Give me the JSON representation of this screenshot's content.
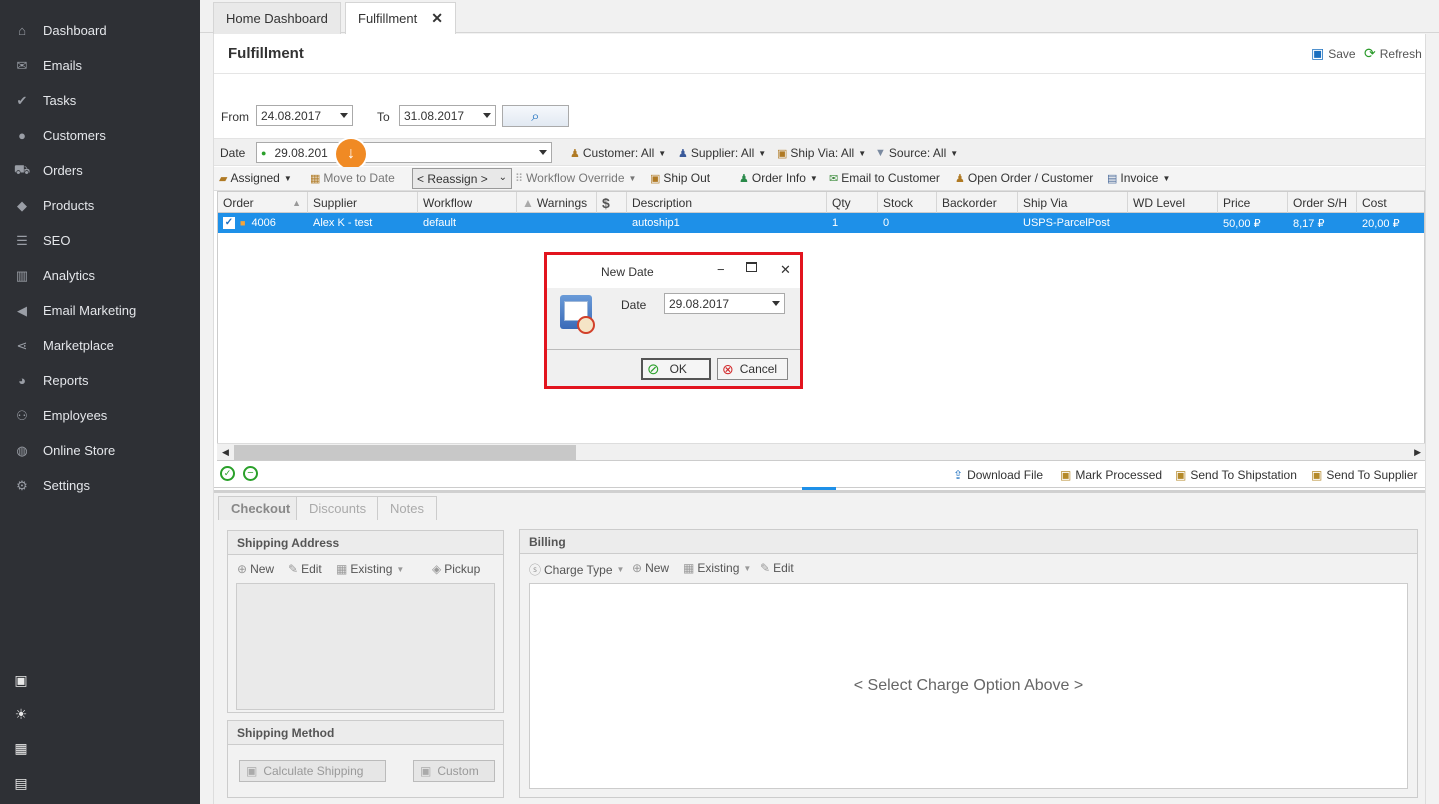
{
  "sidebar": {
    "items": [
      {
        "label": "Dashboard",
        "icon": "home-icon"
      },
      {
        "label": "Emails",
        "icon": "envelope-icon"
      },
      {
        "label": "Tasks",
        "icon": "tasks-icon"
      },
      {
        "label": "Customers",
        "icon": "user-icon"
      },
      {
        "label": "Orders",
        "icon": "cart-icon"
      },
      {
        "label": "Products",
        "icon": "tag-icon"
      },
      {
        "label": "SEO",
        "icon": "sliders-icon"
      },
      {
        "label": "Analytics",
        "icon": "bar-chart-icon"
      },
      {
        "label": "Email Marketing",
        "icon": "megaphone-icon"
      },
      {
        "label": "Marketplace",
        "icon": "share-icon"
      },
      {
        "label": "Reports",
        "icon": "pie-chart-icon"
      },
      {
        "label": "Employees",
        "icon": "users-icon"
      },
      {
        "label": "Online Store",
        "icon": "globe-icon"
      },
      {
        "label": "Settings",
        "icon": "gear-icon"
      }
    ]
  },
  "tabs": {
    "home": "Home Dashboard",
    "fulfillment": "Fulfillment"
  },
  "header": {
    "title": "Fulfillment",
    "save": "Save",
    "refresh": "Refresh"
  },
  "filters": {
    "from_label": "From",
    "from_value": "24.08.2017",
    "to_label": "To",
    "to_value": "31.08.2017",
    "date_label": "Date",
    "date_value": "29.08.201",
    "customer": "Customer: All",
    "supplier": "Supplier: All",
    "ship_via": "Ship Via: All",
    "source": "Source: All"
  },
  "toolbar": {
    "assigned": "Assigned",
    "move_to_date": "Move to Date",
    "reassign": "< Reassign >",
    "workflow_override": "Workflow Override",
    "ship_out": "Ship Out",
    "order_info": "Order Info",
    "email_customer": "Email to Customer",
    "open_order": "Open Order / Customer",
    "invoice": "Invoice"
  },
  "grid": {
    "columns": [
      "Order",
      "Supplier",
      "Workflow",
      "Warnings",
      "$",
      "Description",
      "Qty",
      "Stock",
      "Backorder",
      "Ship Via",
      "WD Level",
      "Price",
      "Order S/H",
      "Cost"
    ],
    "rows": [
      {
        "order": "4006",
        "supplier": "Alex K - test",
        "workflow": "default",
        "warnings": "",
        "dollar": "",
        "description": "autoship1",
        "qty": "1",
        "stock": "0",
        "backorder": "",
        "ship_via": "USPS-ParcelPost",
        "wd_level": "",
        "price": "50,00 ₽",
        "order_sh": "8,17 ₽",
        "cost": "20,00 ₽"
      }
    ]
  },
  "actions": {
    "download": "Download File",
    "mark_processed": "Mark Processed",
    "send_shipstation": "Send To Shipstation",
    "send_supplier": "Send To Supplier"
  },
  "lower_tabs": {
    "checkout": "Checkout",
    "discounts": "Discounts",
    "notes": "Notes"
  },
  "shipping_address": {
    "title": "Shipping Address",
    "new": "New",
    "edit": "Edit",
    "existing": "Existing",
    "pickup": "Pickup"
  },
  "shipping_method": {
    "title": "Shipping Method",
    "calculate": "Calculate Shipping",
    "custom": "Custom"
  },
  "billing": {
    "title": "Billing",
    "charge_type": "Charge Type",
    "new": "New",
    "existing": "Existing",
    "edit": "Edit",
    "placeholder": "< Select Charge Option Above >"
  },
  "modal": {
    "title": "New Date",
    "date_label": "Date",
    "date_value": "29.08.2017",
    "ok": "OK",
    "cancel": "Cancel"
  },
  "colors": {
    "sidebar_bg": "#2e3035",
    "selection": "#1e90e8",
    "modal_border": "#e2141e",
    "accent_orange": "#f08a24"
  }
}
